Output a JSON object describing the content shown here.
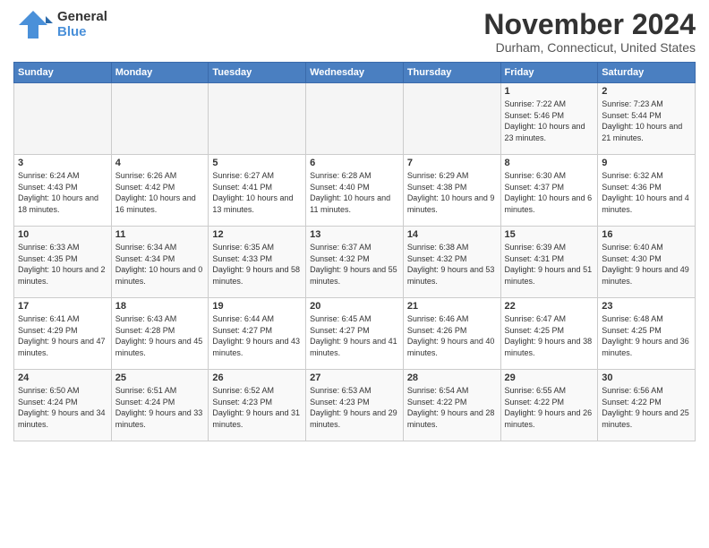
{
  "header": {
    "logo": {
      "line1": "General",
      "line2": "Blue"
    },
    "title": "November 2024",
    "location": "Durham, Connecticut, United States"
  },
  "days_of_week": [
    "Sunday",
    "Monday",
    "Tuesday",
    "Wednesday",
    "Thursday",
    "Friday",
    "Saturday"
  ],
  "weeks": [
    [
      {
        "day": "",
        "info": ""
      },
      {
        "day": "",
        "info": ""
      },
      {
        "day": "",
        "info": ""
      },
      {
        "day": "",
        "info": ""
      },
      {
        "day": "",
        "info": ""
      },
      {
        "day": "1",
        "info": "Sunrise: 7:22 AM\nSunset: 5:46 PM\nDaylight: 10 hours and 23 minutes."
      },
      {
        "day": "2",
        "info": "Sunrise: 7:23 AM\nSunset: 5:44 PM\nDaylight: 10 hours and 21 minutes."
      }
    ],
    [
      {
        "day": "3",
        "info": "Sunrise: 6:24 AM\nSunset: 4:43 PM\nDaylight: 10 hours and 18 minutes."
      },
      {
        "day": "4",
        "info": "Sunrise: 6:26 AM\nSunset: 4:42 PM\nDaylight: 10 hours and 16 minutes."
      },
      {
        "day": "5",
        "info": "Sunrise: 6:27 AM\nSunset: 4:41 PM\nDaylight: 10 hours and 13 minutes."
      },
      {
        "day": "6",
        "info": "Sunrise: 6:28 AM\nSunset: 4:40 PM\nDaylight: 10 hours and 11 minutes."
      },
      {
        "day": "7",
        "info": "Sunrise: 6:29 AM\nSunset: 4:38 PM\nDaylight: 10 hours and 9 minutes."
      },
      {
        "day": "8",
        "info": "Sunrise: 6:30 AM\nSunset: 4:37 PM\nDaylight: 10 hours and 6 minutes."
      },
      {
        "day": "9",
        "info": "Sunrise: 6:32 AM\nSunset: 4:36 PM\nDaylight: 10 hours and 4 minutes."
      }
    ],
    [
      {
        "day": "10",
        "info": "Sunrise: 6:33 AM\nSunset: 4:35 PM\nDaylight: 10 hours and 2 minutes."
      },
      {
        "day": "11",
        "info": "Sunrise: 6:34 AM\nSunset: 4:34 PM\nDaylight: 10 hours and 0 minutes."
      },
      {
        "day": "12",
        "info": "Sunrise: 6:35 AM\nSunset: 4:33 PM\nDaylight: 9 hours and 58 minutes."
      },
      {
        "day": "13",
        "info": "Sunrise: 6:37 AM\nSunset: 4:32 PM\nDaylight: 9 hours and 55 minutes."
      },
      {
        "day": "14",
        "info": "Sunrise: 6:38 AM\nSunset: 4:32 PM\nDaylight: 9 hours and 53 minutes."
      },
      {
        "day": "15",
        "info": "Sunrise: 6:39 AM\nSunset: 4:31 PM\nDaylight: 9 hours and 51 minutes."
      },
      {
        "day": "16",
        "info": "Sunrise: 6:40 AM\nSunset: 4:30 PM\nDaylight: 9 hours and 49 minutes."
      }
    ],
    [
      {
        "day": "17",
        "info": "Sunrise: 6:41 AM\nSunset: 4:29 PM\nDaylight: 9 hours and 47 minutes."
      },
      {
        "day": "18",
        "info": "Sunrise: 6:43 AM\nSunset: 4:28 PM\nDaylight: 9 hours and 45 minutes."
      },
      {
        "day": "19",
        "info": "Sunrise: 6:44 AM\nSunset: 4:27 PM\nDaylight: 9 hours and 43 minutes."
      },
      {
        "day": "20",
        "info": "Sunrise: 6:45 AM\nSunset: 4:27 PM\nDaylight: 9 hours and 41 minutes."
      },
      {
        "day": "21",
        "info": "Sunrise: 6:46 AM\nSunset: 4:26 PM\nDaylight: 9 hours and 40 minutes."
      },
      {
        "day": "22",
        "info": "Sunrise: 6:47 AM\nSunset: 4:25 PM\nDaylight: 9 hours and 38 minutes."
      },
      {
        "day": "23",
        "info": "Sunrise: 6:48 AM\nSunset: 4:25 PM\nDaylight: 9 hours and 36 minutes."
      }
    ],
    [
      {
        "day": "24",
        "info": "Sunrise: 6:50 AM\nSunset: 4:24 PM\nDaylight: 9 hours and 34 minutes."
      },
      {
        "day": "25",
        "info": "Sunrise: 6:51 AM\nSunset: 4:24 PM\nDaylight: 9 hours and 33 minutes."
      },
      {
        "day": "26",
        "info": "Sunrise: 6:52 AM\nSunset: 4:23 PM\nDaylight: 9 hours and 31 minutes."
      },
      {
        "day": "27",
        "info": "Sunrise: 6:53 AM\nSunset: 4:23 PM\nDaylight: 9 hours and 29 minutes."
      },
      {
        "day": "28",
        "info": "Sunrise: 6:54 AM\nSunset: 4:22 PM\nDaylight: 9 hours and 28 minutes."
      },
      {
        "day": "29",
        "info": "Sunrise: 6:55 AM\nSunset: 4:22 PM\nDaylight: 9 hours and 26 minutes."
      },
      {
        "day": "30",
        "info": "Sunrise: 6:56 AM\nSunset: 4:22 PM\nDaylight: 9 hours and 25 minutes."
      }
    ]
  ]
}
